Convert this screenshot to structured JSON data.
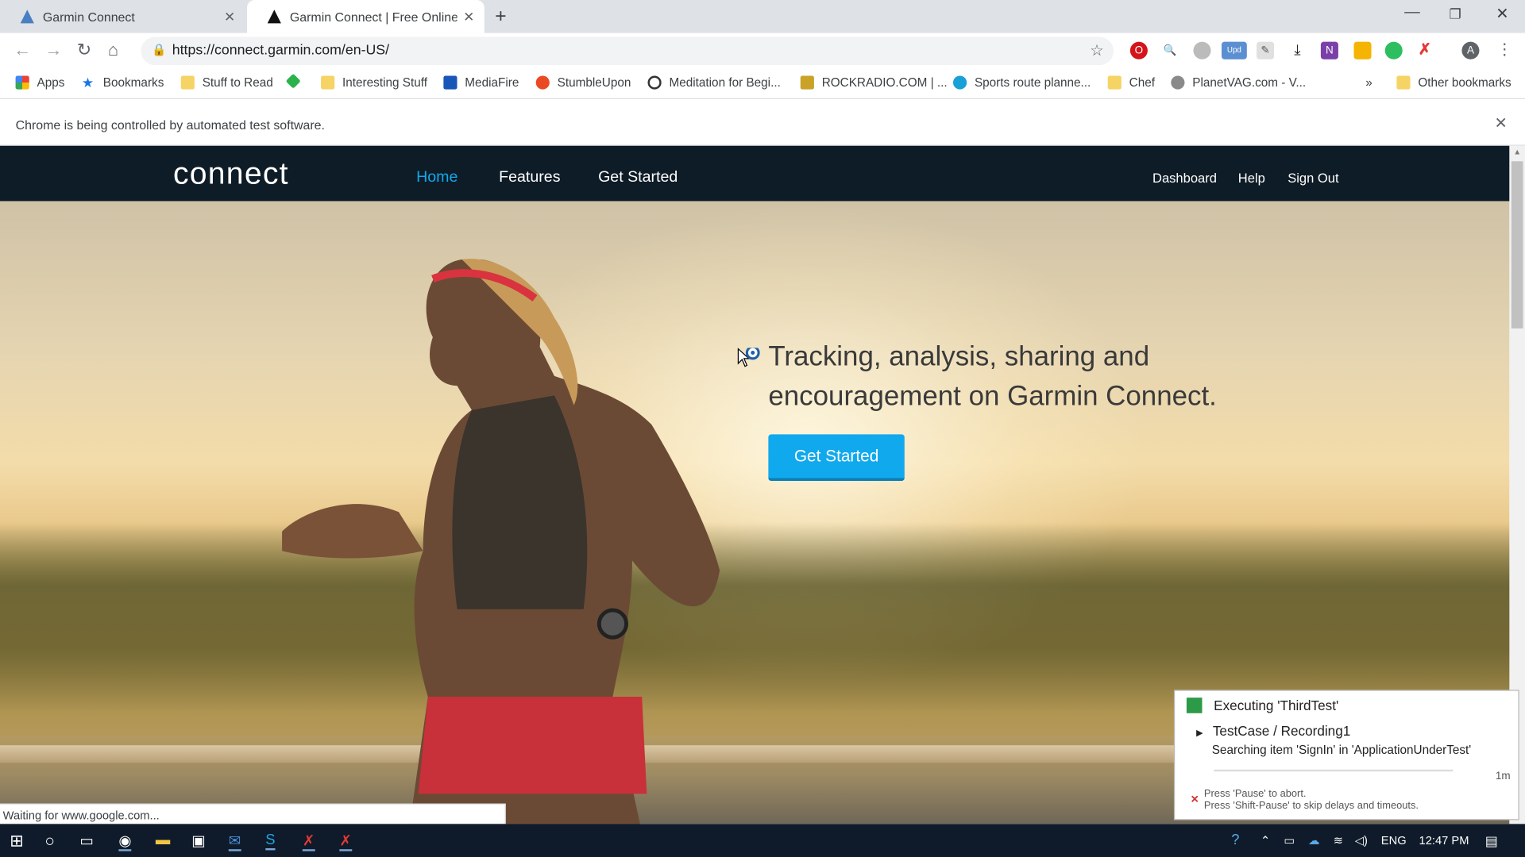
{
  "browser": {
    "tabs": [
      {
        "title": "Garmin Connect",
        "active": false
      },
      {
        "title": "Garmin Connect | Free Online Fit",
        "active": true
      }
    ],
    "new_tab": "+",
    "url": "https://connect.garmin.com/en-US/",
    "bookmarks": [
      {
        "label": "Apps",
        "icon": "apps-grid-icon",
        "color": "#ea4335"
      },
      {
        "label": "Bookmarks",
        "icon": "star-icon",
        "color": "#1a73e8"
      },
      {
        "label": "Stuff to Read",
        "icon": "folder-icon",
        "color": "#f6d365"
      },
      {
        "label": "",
        "icon": "feedly-icon",
        "color": "#2bb24c"
      },
      {
        "label": "Interesting Stuff",
        "icon": "folder-icon",
        "color": "#f6d365"
      },
      {
        "label": "MediaFire",
        "icon": "mediafire-icon",
        "color": "#1a56b8"
      },
      {
        "label": "StumbleUpon",
        "icon": "stumbleupon-icon",
        "color": "#eb4924"
      },
      {
        "label": "Meditation for Begi...",
        "icon": "ring-icon",
        "color": "#333333"
      },
      {
        "label": "ROCKRADIO.COM | ...",
        "icon": "rockradio-icon",
        "color": "#c9a227"
      },
      {
        "label": "Sports route planne...",
        "icon": "route-icon",
        "color": "#19a0d6"
      },
      {
        "label": "Chef",
        "icon": "folder-icon",
        "color": "#f6d365"
      },
      {
        "label": "PlanetVAG.com - V...",
        "icon": "planetvag-icon",
        "color": "#8a8a8a"
      }
    ],
    "more_bookmarks": "»",
    "other_bookmarks": "Other bookmarks",
    "infobar_text": "Chrome is being controlled by automated test software.",
    "status_text": "Waiting for www.google.com..."
  },
  "site": {
    "logo": "connect",
    "nav": [
      "Home",
      "Features",
      "Get Started"
    ],
    "right_nav": [
      "Dashboard",
      "Help",
      "Sign Out"
    ],
    "hero_title": "Tracking, analysis, sharing and encouragement on Garmin Connect.",
    "hero_button": "Get Started",
    "accent_color": "#11a9ed"
  },
  "ranorex": {
    "executing": "Executing 'ThirdTest'",
    "testcase": "TestCase / Recording1",
    "searching": "Searching item 'SignIn' in 'ApplicationUnderTest'",
    "elapsed": "1m",
    "hint1": "Press 'Pause' to abort.",
    "hint2": "Press 'Shift-Pause' to skip delays and timeouts."
  },
  "taskbar": {
    "language": "ENG",
    "time": "12:47 PM"
  }
}
